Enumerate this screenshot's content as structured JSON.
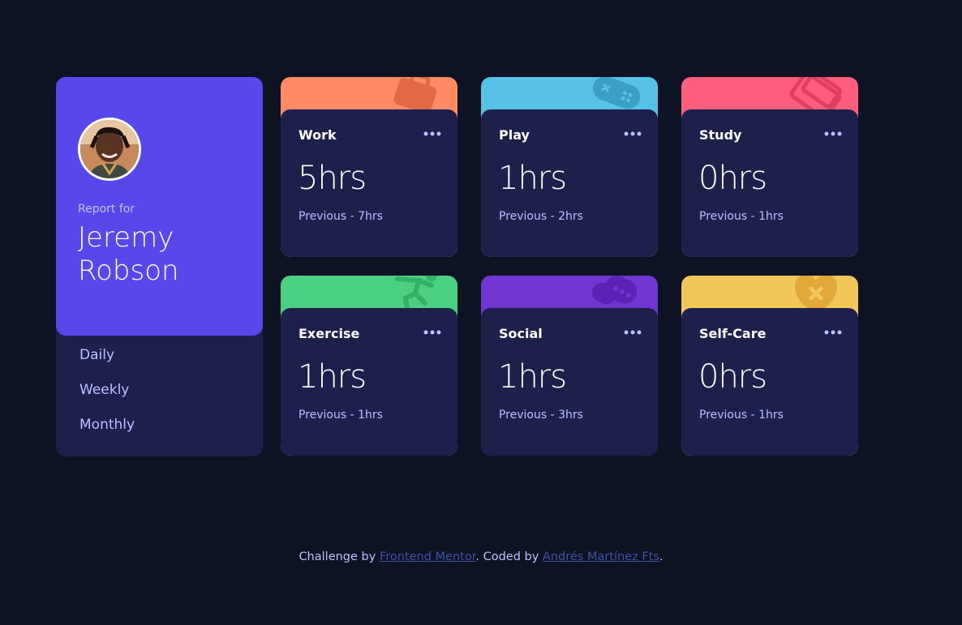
{
  "profile": {
    "report_label": "Report for",
    "name": "Jeremy Robson",
    "periods": [
      "Daily",
      "Weekly",
      "Monthly"
    ]
  },
  "cards": [
    {
      "title": "Work",
      "current": "5hrs",
      "previous": "Previous - 7hrs",
      "color": "#ff8b64",
      "icon": "briefcase-icon"
    },
    {
      "title": "Play",
      "current": "1hrs",
      "previous": "Previous - 2hrs",
      "color": "#55c2e6",
      "icon": "gamepad-icon"
    },
    {
      "title": "Study",
      "current": "0hrs",
      "previous": "Previous - 1hrs",
      "color": "#ff5e7d",
      "icon": "books-icon"
    },
    {
      "title": "Exercise",
      "current": "1hrs",
      "previous": "Previous - 1hrs",
      "color": "#4bcf82",
      "icon": "runner-icon"
    },
    {
      "title": "Social",
      "current": "1hrs",
      "previous": "Previous - 3hrs",
      "color": "#7335d2",
      "icon": "chat-icon"
    },
    {
      "title": "Self-Care",
      "current": "0hrs",
      "previous": "Previous - 1hrs",
      "color": "#f1c75b",
      "icon": "heart-icon"
    }
  ],
  "footer": {
    "prefix": "Challenge by",
    "link1": "Frontend Mentor",
    "middle": ". Coded by",
    "link2": "Andrés Martínez Fts",
    "suffix": "."
  },
  "colors": {
    "background": "#0e1323",
    "card": "#1c204b",
    "accent": "#5847eb",
    "muted_text": "#bbc0ff",
    "link": "#3e52a3"
  }
}
